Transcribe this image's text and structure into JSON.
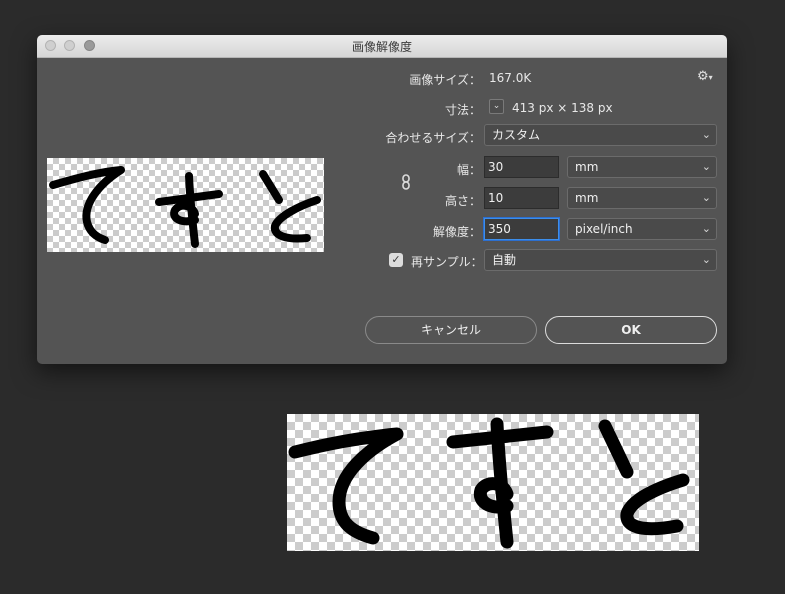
{
  "dialog": {
    "title": "画像解像度",
    "image_size_label": "画像サイズ：",
    "image_size_value": "167.0K",
    "dimensions_label": "寸法：",
    "dimensions_value": "413 px × 138 px",
    "fit_label": "合わせるサイズ：",
    "fit_value": "カスタム",
    "width_label": "幅：",
    "width_value": "30",
    "width_unit": "mm",
    "height_label": "高さ：",
    "height_value": "10",
    "height_unit": "mm",
    "resolution_label": "解像度：",
    "resolution_value": "350",
    "resolution_unit": "pixel/inch",
    "resample_label": "再サンプル：",
    "resample_checked": true,
    "resample_value": "自動",
    "cancel_label": "キャンセル",
    "ok_label": "OK"
  },
  "icons": {
    "settings": "gear-icon",
    "link": "chain-link-icon",
    "chevron": "chevron-down-icon",
    "check": "checkmark-icon"
  },
  "artwork": {
    "text": "てすと"
  }
}
